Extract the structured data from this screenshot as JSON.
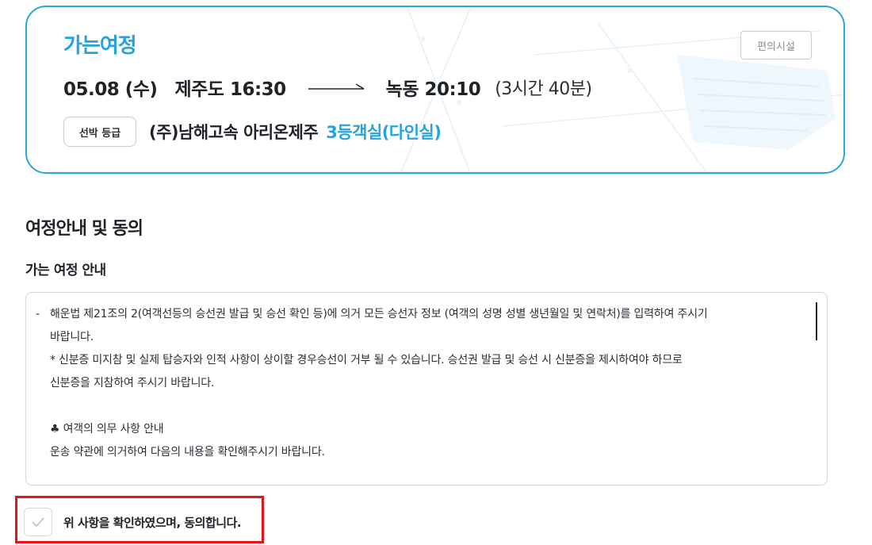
{
  "trip": {
    "title": "가는여정",
    "facility_button": "편의시설",
    "date": "05.08 (수)",
    "departure": "제주도 16:30",
    "arrival": "녹동 20:10",
    "duration": "(3시간 40분)",
    "class_chip": "선박 등급",
    "ship_name": "(주)남해고속 아리온제주",
    "cabin_class": "3등객실(다인실)"
  },
  "section": {
    "title": "여정안내 및 동의",
    "subtitle": "가는 여정 안내"
  },
  "notice": {
    "lines": [
      "해운법 제21조의 2(여객선등의 승선권 발급 및 승선 확인 등)에 의거 모든 승선자 정보 (여객의 성명 성별 생년월일 및 연락처)를 입력하여 주시기",
      "바랍니다.",
      "* 신분증 미지참 및 실제 탑승자와 인적 사항이 상이할 경우승선이 거부 될 수 있습니다. 승선권 발급 및 승선 시 신분증을 제시하여야 하므로",
      "신분증을 지참하여 주시기 바랍니다.",
      "♣ 여객의 의무 사항 안내",
      "운송 약관에 의거하여 다음의 내용을 확인해주시기 바랍니다."
    ]
  },
  "agreement": {
    "label": "위 사항을 확인하였으며, 동의합니다."
  },
  "colors": {
    "accent": "#27a3dc",
    "highlight": "#e8141c"
  }
}
